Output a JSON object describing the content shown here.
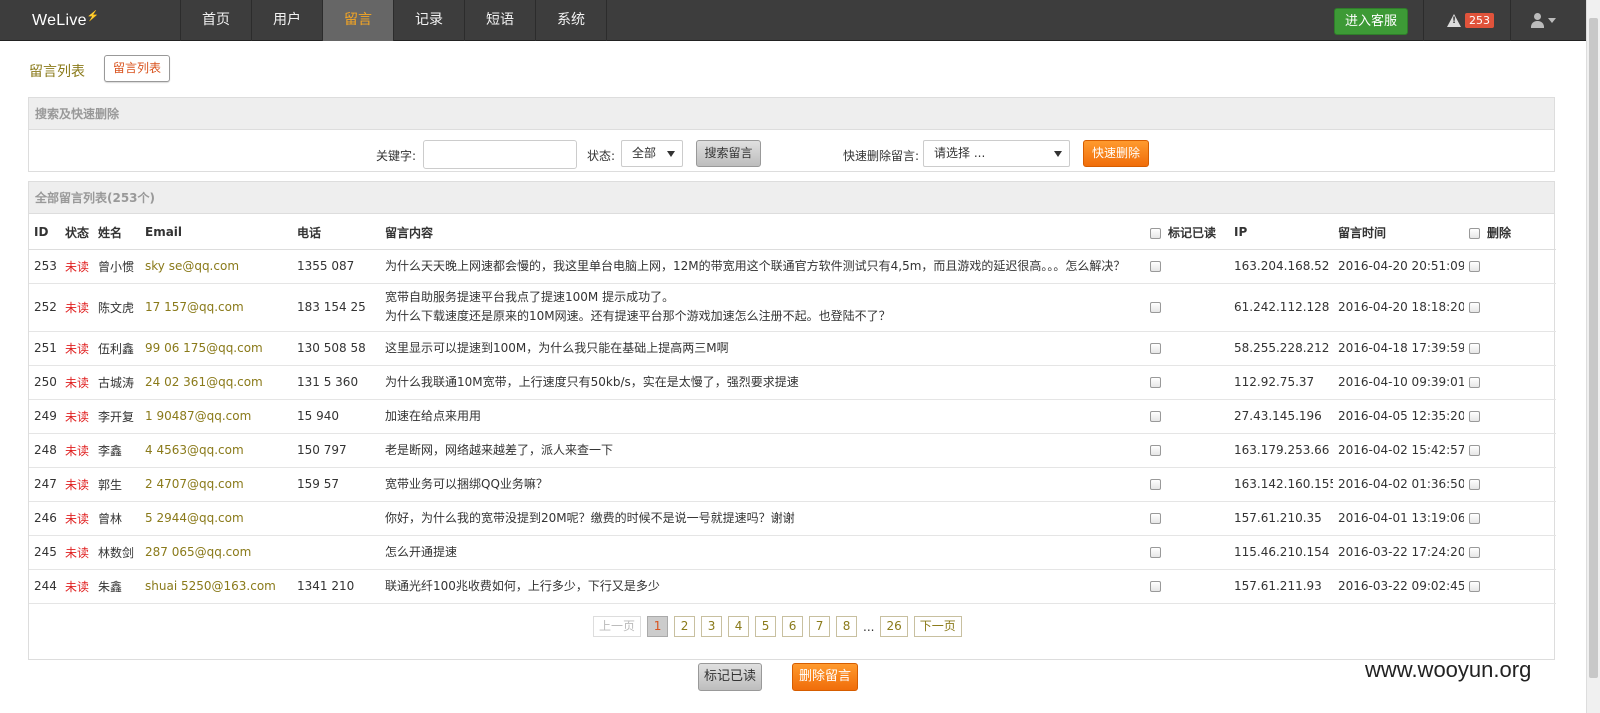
{
  "app": {
    "logo": "WeLive"
  },
  "nav": {
    "items": [
      {
        "label": "首页",
        "active": false
      },
      {
        "label": "用户",
        "active": false
      },
      {
        "label": "留言",
        "active": true
      },
      {
        "label": "记录",
        "active": false
      },
      {
        "label": "短语",
        "active": false
      },
      {
        "label": "系统",
        "active": false
      }
    ],
    "enter_service_label": "进入客服",
    "alert_count": "253"
  },
  "breadcrumb": {
    "title": "留言列表",
    "tab": "留言列表"
  },
  "search": {
    "panel_title": "搜索及快速删除",
    "keyword_label": "关键字:",
    "keyword_value": "",
    "status_label": "状态:",
    "status_value": "全部",
    "search_button": "搜索留言",
    "quick_delete_label": "快速删除留言:",
    "quick_delete_value": "请选择 ...",
    "quick_delete_button": "快速删除"
  },
  "list": {
    "panel_title": "全部留言列表(253个)",
    "columns": {
      "id": "ID",
      "status": "状态",
      "name": "姓名",
      "email": "Email",
      "phone": "电话",
      "content": "留言内容",
      "mark_read": "标记已读",
      "ip": "IP",
      "time": "留言时间",
      "delete": "删除"
    },
    "rows": [
      {
        "id": "253",
        "status": "未读",
        "name": "曾小惯",
        "email": "sky se@qq.com",
        "phone": "1355 087",
        "content": "为什么天天晚上网速都会慢的，我这里单台电脑上网，12M的带宽用这个联通官方软件测试只有4,5m，而且游戏的延迟很高。。。怎么解决？",
        "ip": "163.204.168.52",
        "time": "2016-04-20 20:51:09"
      },
      {
        "id": "252",
        "status": "未读",
        "name": "陈文虎",
        "email": "17 157@qq.com",
        "phone": "183 154 25",
        "content": "宽带自助服务提速平台我点了提速100M 提示成功了。\n为什么下载速度还是原来的10M网速。还有提速平台那个游戏加速怎么注册不起。也登陆不了？",
        "ip": "61.242.112.128",
        "time": "2016-04-20 18:18:20"
      },
      {
        "id": "251",
        "status": "未读",
        "name": "伍利鑫",
        "email": "99 06 175@qq.com",
        "phone": "130 508 58",
        "content": "这里显示可以提速到100M，为什么我只能在基础上提高两三M啊",
        "ip": "58.255.228.212",
        "time": "2016-04-18 17:39:59"
      },
      {
        "id": "250",
        "status": "未读",
        "name": "古城涛",
        "email": "24 02 361@qq.com",
        "phone": "131 5 360",
        "content": "为什么我联通10M宽带，上行速度只有50kb/s，实在是太慢了，强烈要求提速",
        "ip": "112.92.75.37",
        "time": "2016-04-10 09:39:01"
      },
      {
        "id": "249",
        "status": "未读",
        "name": "李开复",
        "email": "1 90487@qq.com",
        "phone": "15 940",
        "content": "加速在给点来用用",
        "ip": "27.43.145.196",
        "time": "2016-04-05 12:35:20"
      },
      {
        "id": "248",
        "status": "未读",
        "name": "李鑫",
        "email": "4 4563@qq.com",
        "phone": "150 797",
        "content": "老是断网，网络越来越差了，派人来查一下",
        "ip": "163.179.253.66",
        "time": "2016-04-02 15:42:57"
      },
      {
        "id": "247",
        "status": "未读",
        "name": "郭生",
        "email": "2 4707@qq.com",
        "phone": "159 57",
        "content": "宽带业务可以捆绑QQ业务嘛？",
        "ip": "163.142.160.155",
        "time": "2016-04-02 01:36:50"
      },
      {
        "id": "246",
        "status": "未读",
        "name": "曾林",
        "email": "5 2944@qq.com",
        "phone": "",
        "content": "你好，为什么我的宽带没提到20M呢？缴费的时候不是说一号就提速吗？谢谢",
        "ip": "157.61.210.35",
        "time": "2016-04-01 13:19:06"
      },
      {
        "id": "245",
        "status": "未读",
        "name": "林数剑",
        "email": "287 065@qq.com",
        "phone": "",
        "content": "怎么开通提速",
        "ip": "115.46.210.154",
        "time": "2016-03-22 17:24:20"
      },
      {
        "id": "244",
        "status": "未读",
        "name": "朱鑫",
        "email": "shuai 5250@163.com",
        "phone": "1341 210",
        "content": "联通光纤100兆收费如何，上行多少，下行又是多少",
        "ip": "157.61.211.93",
        "time": "2016-03-22 09:02:45"
      }
    ]
  },
  "pagination": {
    "prev": "上一页",
    "pages": [
      "1",
      "2",
      "3",
      "4",
      "5",
      "6",
      "7",
      "8"
    ],
    "current": "1",
    "ellipsis": "...",
    "last": "26",
    "next": "下一页"
  },
  "actions": {
    "mark_read": "标记已读",
    "delete": "删除留言"
  },
  "watermark": "www.wooyun.org",
  "colors": {
    "nav_bg": "#3d3d3d",
    "accent": "#f5a623",
    "unread": "#e02020",
    "email": "#8a7a1a",
    "primary_orange": "#f06d0a",
    "service_green": "#3d9a36"
  }
}
